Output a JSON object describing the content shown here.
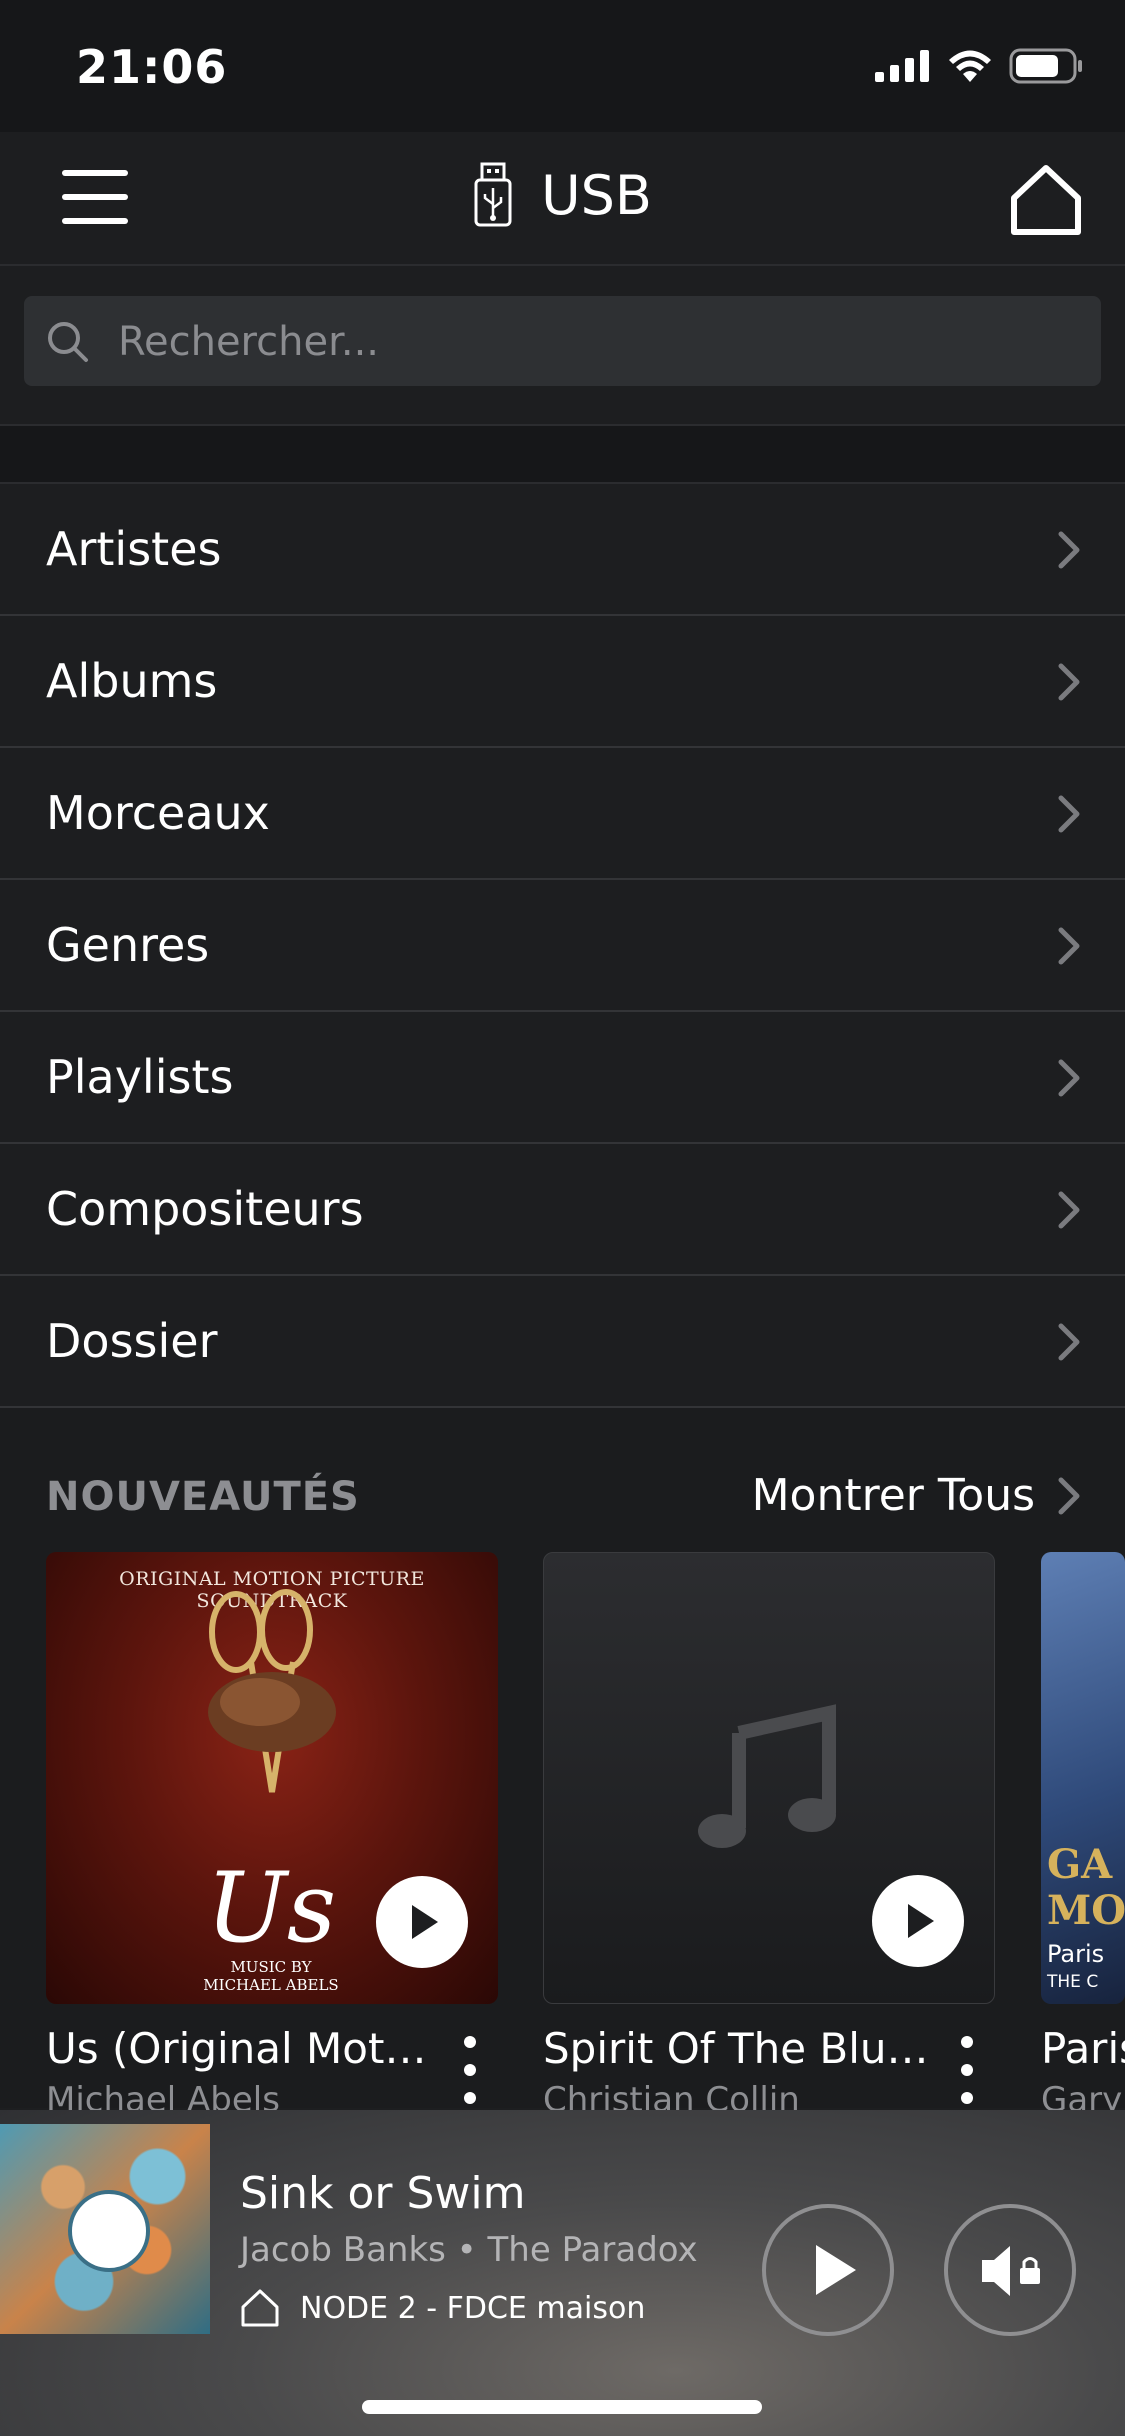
{
  "status_bar": {
    "time": "21:06"
  },
  "header": {
    "title": "USB"
  },
  "search": {
    "placeholder": "Rechercher..."
  },
  "menu": [
    {
      "label": "Artistes"
    },
    {
      "label": "Albums"
    },
    {
      "label": "Morceaux"
    },
    {
      "label": "Genres"
    },
    {
      "label": "Playlists"
    },
    {
      "label": "Compositeurs"
    },
    {
      "label": "Dossier"
    }
  ],
  "new_releases": {
    "title": "NOUVEAUTÉS",
    "show_all": "Montrer Tous",
    "albums": [
      {
        "title": "Us (Original Motion Picture Soundtrack)",
        "artist": "Michael Abels",
        "cover_top": "ORIGINAL MOTION PICTURE SOUNDTRACK",
        "cover_title": "Us",
        "cover_credit": "MUSIC BY\nMICHAEL ABELS"
      },
      {
        "title": "Spirit Of The Blues",
        "artist": "Christian Collin"
      },
      {
        "title": "Paris",
        "artist": "Gary M",
        "cover_title": "GA MO",
        "cover_sub": "Paris",
        "cover_small": "THE C"
      }
    ]
  },
  "now_playing": {
    "title": "Sink or Swim",
    "artist_album": "Jacob Banks • The Paradox",
    "zone": "NODE 2 - FDCE maison"
  },
  "colors": {
    "background": "#1d1e20",
    "status_bar": "#161719",
    "muted_text": "#8d8e92"
  }
}
